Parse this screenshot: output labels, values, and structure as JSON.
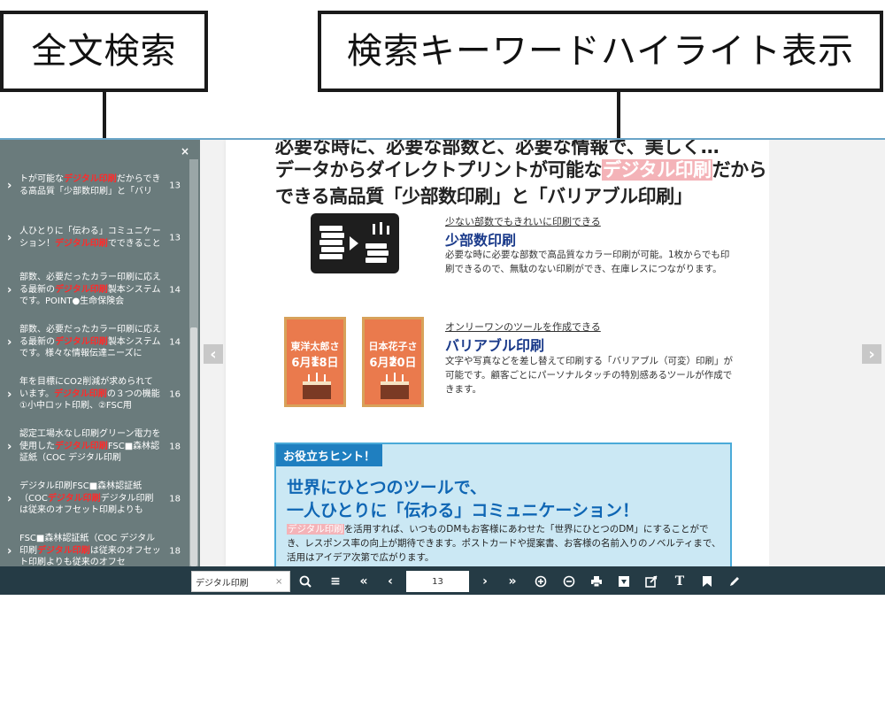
{
  "callouts": {
    "left": "全文検索",
    "right": "検索キーワードハイライト表示"
  },
  "sidebar": {
    "close": "×",
    "results": [
      {
        "before": "トが可能な",
        "keyword": "デジタル印刷",
        "after": "だからできる高品質「少部数印刷」と「バリ",
        "page": "13"
      },
      {
        "before": "人ひとりに「伝わる」コミュニケーション！",
        "keyword": "デジタル印刷",
        "after": "でできること",
        "page": "13"
      },
      {
        "before": "部数、必要だったカラー印刷に応える最新の",
        "keyword": "デジタル印刷",
        "after": "製本システムです。POINT●生命保険会",
        "page": "14"
      },
      {
        "before": "部数、必要だったカラー印刷に応える最新の",
        "keyword": "デジタル印刷",
        "after": "製本システムです。様々な情報伝達ニーズに",
        "page": "14"
      },
      {
        "before": "年を目標にCO2削減が求められています。",
        "keyword": "デジタル印刷",
        "after": "の３つの機能①小中ロット印刷、②FSC用",
        "page": "16"
      },
      {
        "before": "認定工場水なし印刷グリーン電力を使用した",
        "keyword": "デジタル印刷",
        "after": "FSC■森林認証紙（COC デジタル印刷",
        "page": "18"
      },
      {
        "before": "デジタル印刷FSC■森林認証紙（COC",
        "keyword": "デジタル印刷",
        "after": "デジタル印刷は従来のオフセット印刷よりも",
        "page": "18"
      },
      {
        "before": "FSC■森林認証紙（COC デジタル印刷",
        "keyword": "デジタル印刷",
        "after": "は従来のオフセット印刷よりも従来のオフセ",
        "page": "18"
      }
    ]
  },
  "page": {
    "cut_headline": "必要な時に、必要な部数と、必要な情報で、美しく…",
    "headline1_before": "データからダイレクトプリントが可能な",
    "headline1_keyword": "デジタル印刷",
    "headline1_after": "だから",
    "headline2": "できる高品質「少部数印刷」と「バリアブル印刷」",
    "feature1": {
      "sub": "少ない部数でもきれいに印刷できる",
      "title": "少部数印刷",
      "body": "必要な時に必要な部数で高品質なカラー印刷が可能。1枚からでも印刷できるので、無駄のない印刷ができ、在庫レスにつながります。"
    },
    "feature2": {
      "sub": "オンリーワンのツールを作成できる",
      "title": "バリアブル印刷",
      "body": "文字や写真などを差し替えて印刷する「バリアブル（可変）印刷」が可能です。顧客ごとにパーソナルタッチの特別感あるツールが作成できます。"
    },
    "cards": [
      {
        "name": "東洋太郎さま",
        "date": "6月18日"
      },
      {
        "name": "日本花子さま",
        "date": "6月20日"
      }
    ],
    "tip": {
      "badge": "お役立ちヒント！",
      "head1": "世界にひとつのツールで、",
      "head2": "一人ひとりに「伝わる」コミュニケーション！",
      "body_keyword": "デジタル印刷",
      "body_rest": "を活用すれば、いつものDMもお客様にあわせた「世界にひとつのDM」にすることができ、レスポンス率の向上が期待できます。ポストカードや提案書、お客様の名前入りのノベルティまで、活用はアイデア次第で広がります。"
    }
  },
  "toolbar": {
    "search_value": "デジタル印刷",
    "search_clear": "×",
    "page_value": "13"
  },
  "colors": {
    "sidebar": "#6a7b7c",
    "toolbar": "#253b45",
    "keyword_red": "#ff2b2b",
    "keyword_pink": "#f4b3b8",
    "tip_bg": "#cbe8f4",
    "tip_head": "#0f66b4"
  },
  "icons": [
    "chevron-left-icon",
    "chevron-right-icon",
    "search-icon",
    "list-icon",
    "first-page-icon",
    "prev-page-icon",
    "next-page-icon",
    "last-page-icon",
    "zoom-in-icon",
    "zoom-out-icon",
    "print-icon",
    "download-icon",
    "share-icon",
    "text-icon",
    "bookmark-icon",
    "pen-icon"
  ]
}
